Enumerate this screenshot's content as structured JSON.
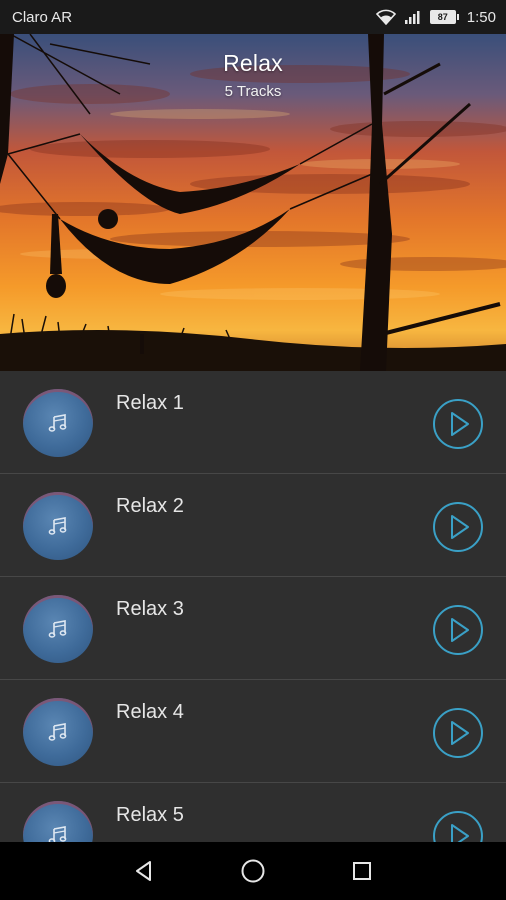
{
  "status_bar": {
    "carrier": "Claro AR",
    "battery_level": "87",
    "time": "1:50"
  },
  "header": {
    "title": "Relax",
    "subtitle": "5 Tracks"
  },
  "tracks": [
    {
      "title": "Relax 1"
    },
    {
      "title": "Relax 2"
    },
    {
      "title": "Relax 3"
    },
    {
      "title": "Relax 4"
    },
    {
      "title": "Relax 5"
    }
  ],
  "icons": {
    "track_art": "music-note-icon",
    "play": "play-icon",
    "nav_back": "back-triangle-icon",
    "nav_home": "home-circle-icon",
    "nav_recents": "recents-square-icon"
  },
  "colors": {
    "accent": "#3aa0c6",
    "list_background": "#2f2f2f",
    "divider": "#474747"
  }
}
